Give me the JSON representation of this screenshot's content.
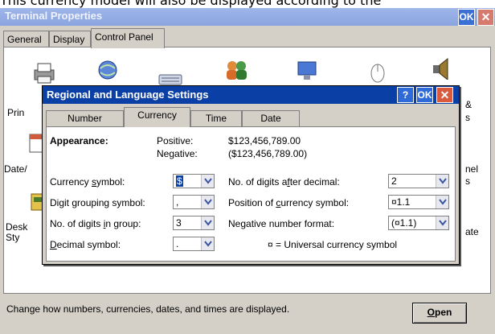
{
  "caption": "This currency model will also be displayed according to the",
  "outer_window": {
    "title": "Terminal Properties",
    "ok_label": "OK",
    "close_label": "✕",
    "tabs": [
      "General",
      "Display",
      "Control Panel"
    ],
    "status_text": "Change how numbers, currencies, dates, and times are displayed.",
    "open_button": {
      "underlined": "O",
      "rest": "pen"
    },
    "icons_left": [
      {
        "label": "Prin",
        "icon": "printer-icon"
      },
      {
        "label": "Date/",
        "icon": "calendar-icon"
      },
      {
        "label": "Desk\nSty",
        "icon": "desktop-icon"
      }
    ],
    "icons_right": [
      {
        "label": "&",
        "icon": "audio-icon"
      },
      {
        "label": "s",
        "icon": "audio-icon"
      },
      {
        "label": "nel\ns",
        "icon": "panel-icon"
      },
      {
        "label": "ate",
        "icon": "date-icon"
      }
    ]
  },
  "dialog": {
    "title": "Regional and Language Settings",
    "help_label": "?",
    "ok_label": "OK",
    "close_label": "✕",
    "tabs": [
      "Number",
      "Currency",
      "Time",
      "Date"
    ],
    "active_tab": "Currency",
    "appearance_label": "Appearance:",
    "positive_label": "Positive:",
    "positive_value": "$123,456,789.00",
    "negative_label": "Negative:",
    "negative_value": "($123,456,789.00)",
    "fields_left": [
      {
        "pre": "Currency ",
        "u": "s",
        "post": "ymbol:",
        "value": "$"
      },
      {
        "pre": "Digit ",
        "u": "g",
        "post": "rouping symbol:",
        "value": ","
      },
      {
        "pre": "No. of digits ",
        "u": "i",
        "post": "n group:",
        "value": "3"
      },
      {
        "pre": "",
        "u": "D",
        "post": "ecimal symbol:",
        "value": "."
      }
    ],
    "fields_right": [
      {
        "pre": "No. of digits a",
        "u": "f",
        "post": "ter decimal:",
        "value": "2"
      },
      {
        "pre": "Position of ",
        "u": "c",
        "post": "urrency symbol:",
        "value": "¤1.1"
      },
      {
        "pre": "Negative number format:",
        "u": "",
        "post": "",
        "value": "(¤1.1)"
      }
    ],
    "note": "¤ = Universal currency symbol"
  }
}
